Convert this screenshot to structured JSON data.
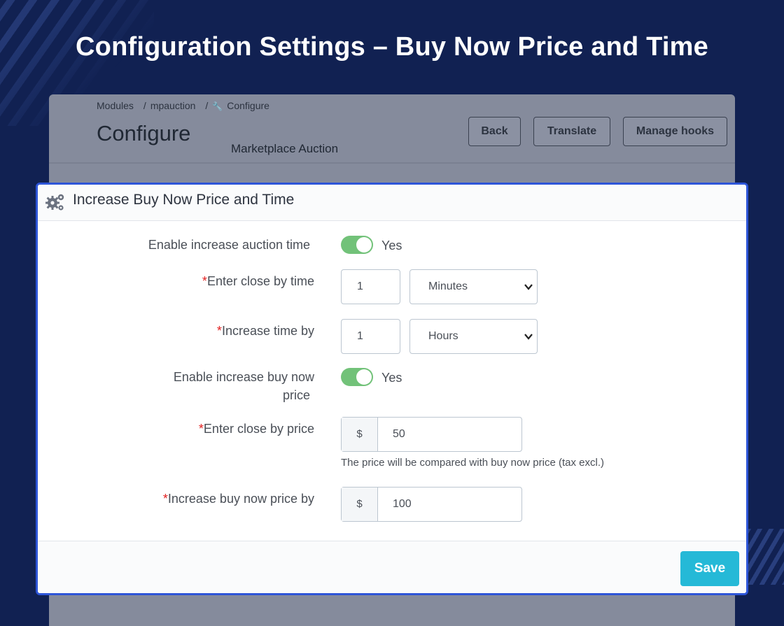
{
  "hero": {
    "title": "Configuration Settings – Buy Now Price and Time"
  },
  "background": {
    "breadcrumb": [
      "Modules",
      "mpauction",
      "Configure"
    ],
    "page_title": "Configure",
    "subtitle": "Marketplace Auction",
    "buttons": {
      "back": "Back",
      "translate": "Translate",
      "manage_hooks": "Manage hooks"
    }
  },
  "card": {
    "title": "Increase Buy Now Price and Time",
    "fields": {
      "enable_time": {
        "label": "Enable increase auction time",
        "value": "Yes"
      },
      "close_by_time": {
        "required_mark": "*",
        "label": "Enter close by time",
        "value": "1",
        "unit": "Minutes"
      },
      "increase_time": {
        "required_mark": "*",
        "label": "Increase time by",
        "value": "1",
        "unit": "Hours"
      },
      "enable_price": {
        "label_line1": "Enable increase buy now",
        "label_line2": "price",
        "value": "Yes"
      },
      "close_by_price": {
        "required_mark": "*",
        "label": "Enter close by price",
        "currency": "$",
        "value": "50",
        "help": "The price will be compared with buy now price (tax excl.)"
      },
      "increase_price": {
        "required_mark": "*",
        "label": "Increase buy now price by",
        "currency": "$",
        "value": "100"
      }
    },
    "save_label": "Save"
  },
  "colors": {
    "page_bg": "#112152",
    "accent_border": "#2d55d8",
    "toggle_on": "#72c279",
    "save_button": "#25b9d7",
    "required": "#e21f1f"
  }
}
